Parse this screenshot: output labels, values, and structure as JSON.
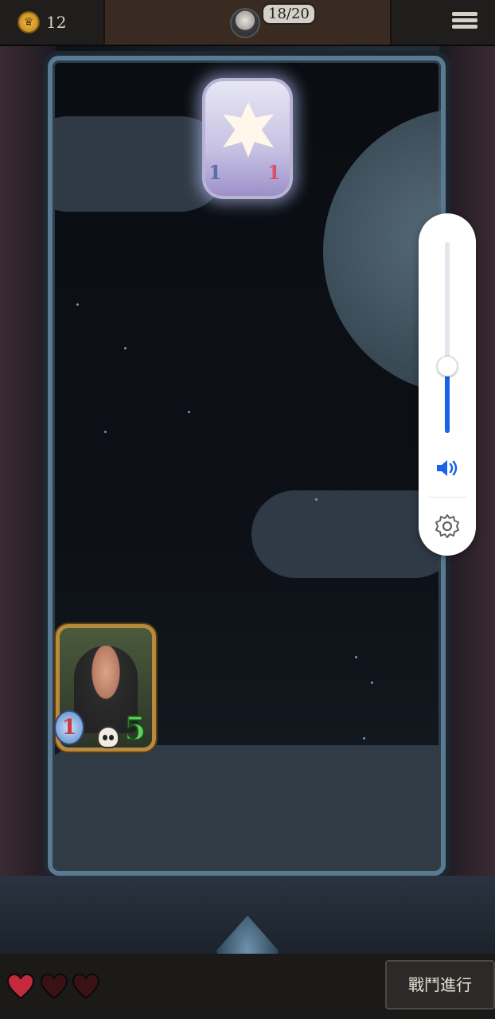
{
  "topbar": {
    "coins": "12",
    "deck_count": "18/20"
  },
  "enemy_card": {
    "attack": "1",
    "health": "1"
  },
  "player_card": {
    "attack": "1",
    "health": "5"
  },
  "volume": {
    "level": 0.35,
    "accent_color": "#1a63e8"
  },
  "lives": {
    "hearts": 3,
    "filled": 1
  },
  "actions": {
    "battle_label": "戰鬥進行"
  }
}
